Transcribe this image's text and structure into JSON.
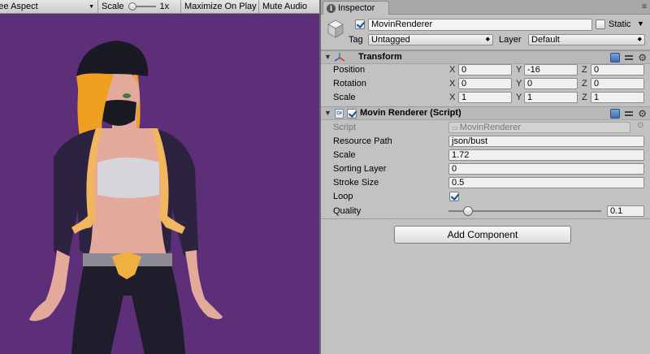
{
  "game_view": {
    "aspect_label": "Free Aspect",
    "scale_label": "Scale",
    "scale_value": "1x",
    "scale_fraction": 0.0,
    "maximize_label": "Maximize On Play",
    "mute_label": "Mute Audio",
    "background_color": "#5d2f78"
  },
  "inspector": {
    "tab_label": "Inspector",
    "gameobject": {
      "active": true,
      "name": "MovinRenderer",
      "static_label": "Static",
      "static_checked": false,
      "tag_label": "Tag",
      "tag_value": "Untagged",
      "layer_label": "Layer",
      "layer_value": "Default"
    },
    "transform": {
      "title": "Transform",
      "rows": [
        {
          "label": "Position",
          "x": "0",
          "y": "-16",
          "z": "0"
        },
        {
          "label": "Rotation",
          "x": "0",
          "y": "0",
          "z": "0"
        },
        {
          "label": "Scale",
          "x": "1",
          "y": "1",
          "z": "1"
        }
      ],
      "axis_labels": [
        "X",
        "Y",
        "Z"
      ]
    },
    "movin_renderer": {
      "title": "Movin Renderer (Script)",
      "enabled": true,
      "script_label": "Script",
      "script_value": "MovinRenderer",
      "resource_path_label": "Resource Path",
      "resource_path_value": "json/bust",
      "scale_label": "Scale",
      "scale_value": "1.72",
      "sorting_layer_label": "Sorting Layer",
      "sorting_layer_value": "0",
      "stroke_size_label": "Stroke Size",
      "stroke_size_value": "0.5",
      "loop_label": "Loop",
      "loop_checked": true,
      "quality_label": "Quality",
      "quality_value": "0.1",
      "quality_fraction": 0.1
    },
    "add_component_label": "Add Component"
  },
  "colors": {
    "hair": "#f0a020",
    "skin": "#e3a99a",
    "jacket": "#2c2340",
    "jacket_trim": "#f2b660",
    "top": "#d8d4dc",
    "pants": "#1f1d2c",
    "belt": "#8f8a96",
    "buckle": "#f0b040"
  }
}
